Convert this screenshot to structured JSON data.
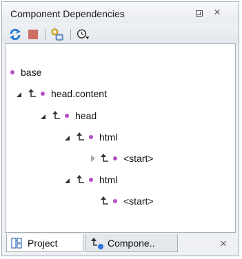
{
  "panel": {
    "title": "Component Dependencies",
    "restore_label": "",
    "close_label": "×"
  },
  "toolbar": {
    "buttons": [
      {
        "name": "refresh-dependencies",
        "icon": "refresh-icon"
      },
      {
        "name": "stop",
        "icon": "stop-icon"
      },
      {
        "name": "configure-scope",
        "icon": "scope-settings-icon"
      },
      {
        "name": "history",
        "icon": "history-icon"
      }
    ]
  },
  "tree": {
    "nodes": [
      {
        "label": "base",
        "level": 0,
        "state": "leaf-root"
      },
      {
        "label": "head.content",
        "level": 1,
        "state": "expanded"
      },
      {
        "label": "head",
        "level": 2,
        "state": "expanded"
      },
      {
        "label": "html",
        "level": 3,
        "state": "expanded"
      },
      {
        "label": "<start>",
        "level": 4,
        "state": "collapsed"
      },
      {
        "label": "html",
        "level": 3,
        "state": "expanded"
      },
      {
        "label": "<start>",
        "level": 4,
        "state": "leaf"
      }
    ]
  },
  "tabs": [
    {
      "label": "Project",
      "icon": "project-icon",
      "active": true
    },
    {
      "label": "Compone..",
      "icon": "component-dependencies-icon",
      "active": false
    }
  ],
  "tab_close_label": "×",
  "colors": {
    "node_dot": "#b44ec4",
    "refresh": "#2a7fd4",
    "stop": "#c9574a"
  }
}
